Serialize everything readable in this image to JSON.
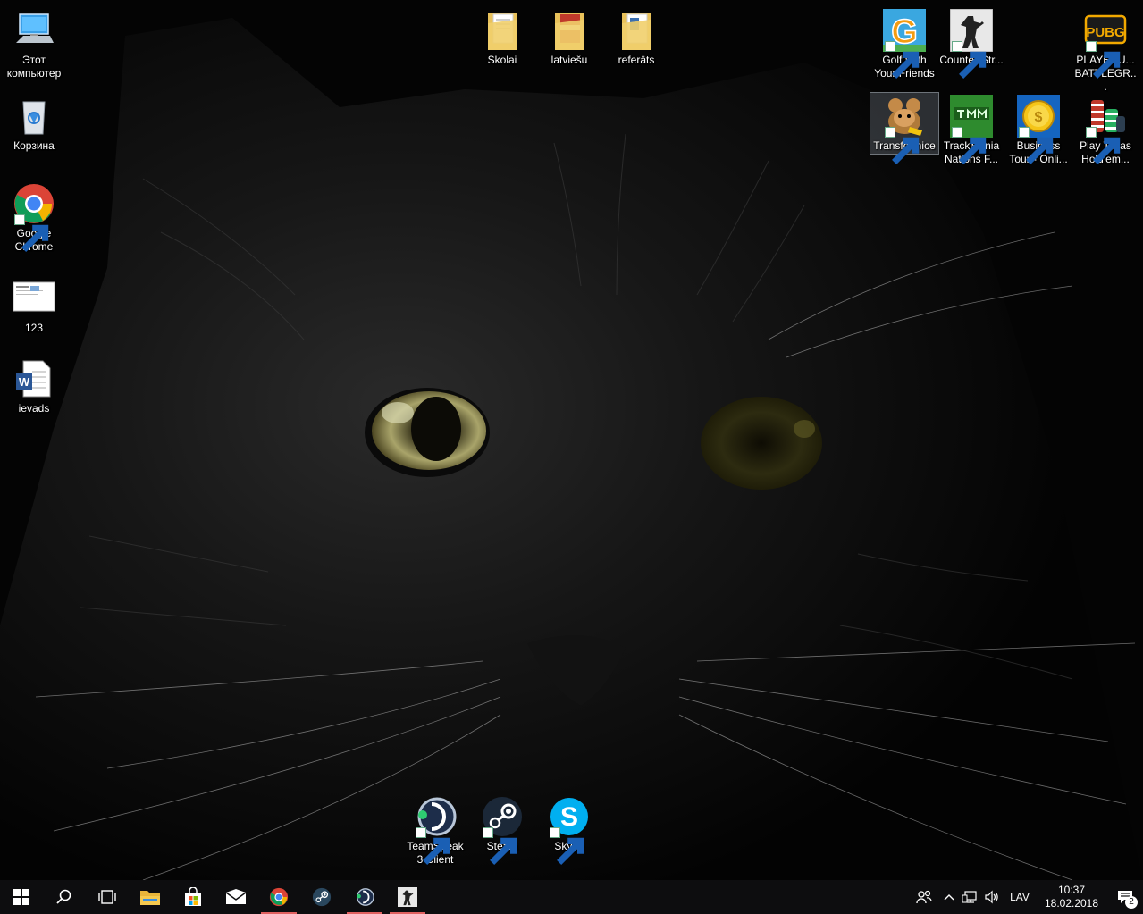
{
  "desktop": {
    "icons_left": [
      {
        "label": "Этот компьютер",
        "icon": "this-pc-icon"
      },
      {
        "label": "Корзина",
        "icon": "recycle-bin-icon"
      },
      {
        "label": "Google Chrome",
        "icon": "chrome-icon"
      },
      {
        "label": "123",
        "icon": "image-file-icon"
      },
      {
        "label": "ievads",
        "icon": "word-document-icon"
      }
    ],
    "icons_top": [
      {
        "label": "Skolai",
        "icon": "folder-icon"
      },
      {
        "label": "latviešu",
        "icon": "folder-icon"
      },
      {
        "label": "referāts",
        "icon": "folder-icon"
      }
    ],
    "icons_right_row1": [
      {
        "label": "Golf With Your Friends",
        "icon": "golf-with-your-friends-icon"
      },
      {
        "label": "Counter-Str...",
        "icon": "counter-strike-icon"
      },
      {
        "label": "PLAYERU... BATTLEGR...",
        "icon": "pubg-icon"
      }
    ],
    "icons_right_row2": [
      {
        "label": "Transformice",
        "icon": "transformice-icon"
      },
      {
        "label": "TrackMania Nations F...",
        "icon": "trackmania-icon"
      },
      {
        "label": "Business Tour - Onli...",
        "icon": "business-tour-icon"
      },
      {
        "label": "Play Texas Hold'em...",
        "icon": "poker-chips-icon"
      }
    ],
    "icons_bottom": [
      {
        "label": "TeamSpeak 3 Client",
        "icon": "teamspeak-icon"
      },
      {
        "label": "Steam",
        "icon": "steam-icon"
      },
      {
        "label": "Skype",
        "icon": "skype-icon"
      }
    ],
    "pubg_logo_text": "PUBG"
  },
  "taskbar": {
    "buttons": [
      "start-button",
      "search-button",
      "task-view-button",
      "file-explorer",
      "microsoft-store",
      "mail",
      "chrome",
      "steam",
      "teamspeak",
      "counter-strike"
    ],
    "tray": {
      "language": "LAV",
      "time": "10:37",
      "date": "18.02.2018",
      "notification_count": "2"
    }
  },
  "colors": {
    "taskbar_bg": "#0d0d0f",
    "running_indicator": "#e06060",
    "folder_yellow": "#e8c15a"
  }
}
